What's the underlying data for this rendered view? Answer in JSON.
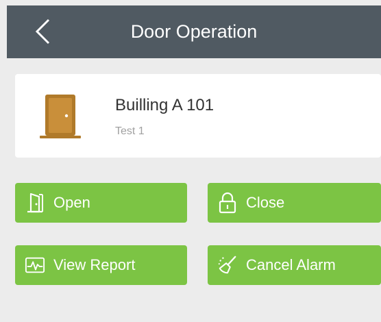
{
  "header": {
    "title": "Door Operation",
    "back_icon": "chevron-left-icon"
  },
  "door": {
    "name": "Builling A 101",
    "subtitle": "Test 1",
    "icon": "door-icon",
    "icon_color": "#b07a2a"
  },
  "actions": [
    {
      "label": "Open",
      "icon": "door-open-icon"
    },
    {
      "label": "Close",
      "icon": "lock-icon"
    },
    {
      "label": "View Report",
      "icon": "report-chart-icon"
    },
    {
      "label": "Cancel Alarm",
      "icon": "broom-icon"
    }
  ],
  "colors": {
    "header_bg": "#505a62",
    "accent_green": "#7cc444",
    "page_bg": "#ececec"
  }
}
